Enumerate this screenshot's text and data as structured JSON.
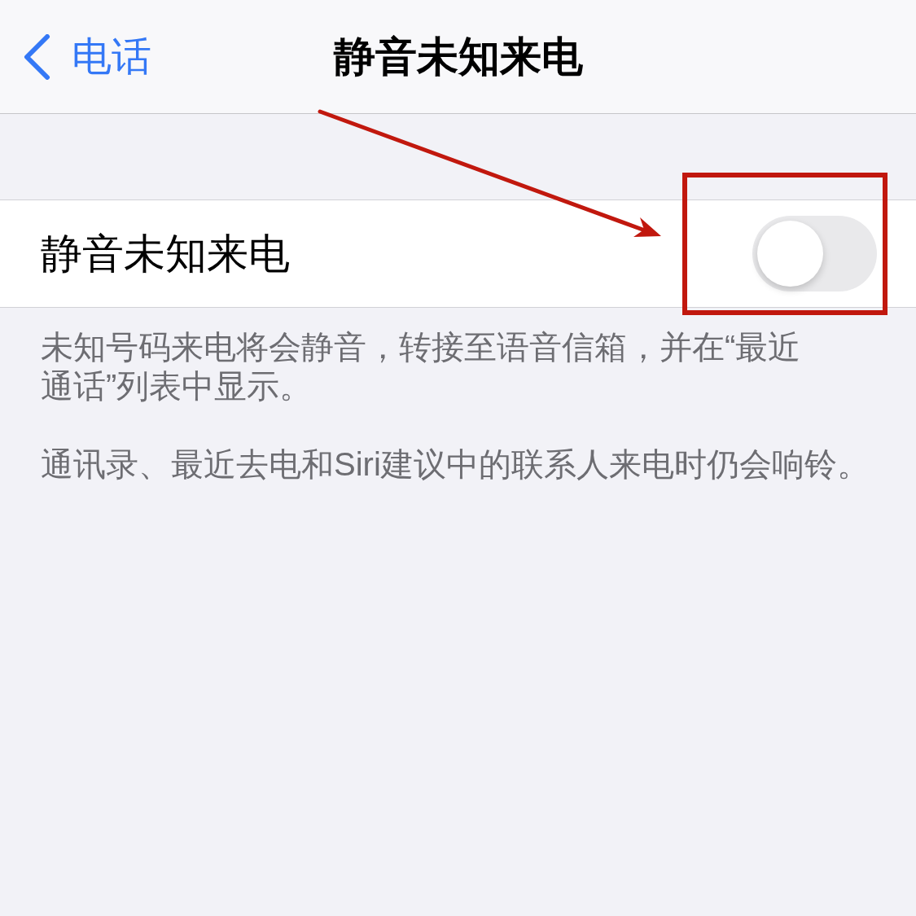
{
  "nav_bar": {
    "back_label": "电话",
    "title": "静音未知来电"
  },
  "settings": [
    {
      "kind": "toggle",
      "label": "静音未知来电",
      "on": false
    }
  ],
  "footer": [
    "未知号码来电将会静音，转接至语音信箱，并在“最近通话”列表中显示。",
    "通讯录、最近去电和Siri建议中的联系人来电时仍会响铃。"
  ]
}
